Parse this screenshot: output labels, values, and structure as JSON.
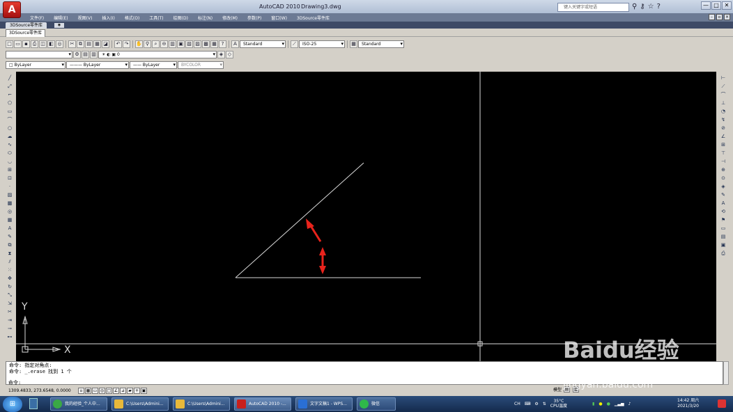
{
  "window": {
    "app_title": "AutoCAD 2010",
    "doc_title": "Drawing3.dwg",
    "logo_letter": "A",
    "search_placeholder": "键入关键字或短语",
    "min": "—",
    "max": "□",
    "close": "✕"
  },
  "menu": [
    "文件(F)",
    "编辑(E)",
    "视图(V)",
    "插入(I)",
    "格式(O)",
    "工具(T)",
    "绘图(D)",
    "标注(N)",
    "修改(M)",
    "参数(P)",
    "窗口(W)",
    "3DSource零件库"
  ],
  "tabs": {
    "top_tab": "3DSource零件库",
    "second_tab": "3DSource零件库"
  },
  "styles": {
    "text_style": "Standard",
    "dim_style": "ISO-25",
    "table_style": "Standard"
  },
  "layer": {
    "current": "0"
  },
  "properties": {
    "color": "ByLayer",
    "linetype": "ByLayer",
    "lineweight": "ByLayer",
    "plotstyle": "BYCOLOR"
  },
  "ucs": {
    "x_label": "X",
    "y_label": "Y"
  },
  "command": {
    "line1": "命令: 指定对角点:",
    "line2": "命令: _.erase 找到 1 个",
    "prompt": "命令:"
  },
  "status": {
    "coordinates": "1309.4833, 273.6548, 0.0000",
    "model_label": "模型"
  },
  "taskbar": {
    "items": [
      "我的经验_个人中...",
      "C:\\Users\\Admini...",
      "C:\\Users\\Admini...",
      "AutoCAD 2010 -...",
      "文字文稿1 - WPS...",
      "微信"
    ],
    "temp": "35°C",
    "cpu_label": "CPU温度",
    "time": "14:42 周六",
    "date": "2021/3/20"
  },
  "watermark": {
    "brand": "Baidu经验",
    "url": "jingyan.baidu.com"
  },
  "colors": {
    "canvas": "#000000",
    "line": "#d8d8d8",
    "arrow": "#e8231c"
  }
}
